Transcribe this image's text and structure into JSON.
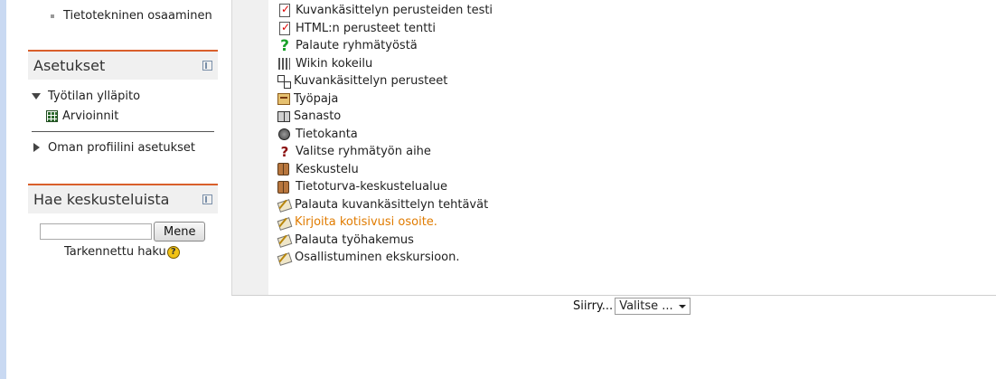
{
  "nav": {
    "top_item": "Tietotekninen osaaminen"
  },
  "settings_block": {
    "title": "Asetukset",
    "workspace": "Työtilan ylläpito",
    "grades": "Arvioinnit",
    "profile": "Oman profiilini asetukset"
  },
  "forum_search_block": {
    "title": "Hae keskusteluista",
    "input_value": "",
    "button_label": "Mene",
    "advanced_label": "Tarkennettu haku",
    "help_glyph": "?"
  },
  "activities": [
    {
      "icon": "quiz-icon",
      "label": "Kuvankäsittelyn perusteiden testi"
    },
    {
      "icon": "quiz-icon",
      "label": "HTML:n perusteet tentti"
    },
    {
      "icon": "feedback-icon",
      "label": "Palaute ryhmätyöstä"
    },
    {
      "icon": "wiki-icon",
      "label": "Wikin kokeilu"
    },
    {
      "icon": "lesson-icon",
      "label": "Kuvankäsittelyn perusteet"
    },
    {
      "icon": "workshop-icon",
      "label": "Työpaja"
    },
    {
      "icon": "glossary-icon",
      "label": "Sanasto"
    },
    {
      "icon": "database-icon",
      "label": "Tietokanta"
    },
    {
      "icon": "choice-icon",
      "label": "Valitse ryhmätyön aihe"
    },
    {
      "icon": "forum-icon",
      "label": "Keskustelu"
    },
    {
      "icon": "forum-icon",
      "label": "Tietoturva-keskustelualue"
    },
    {
      "icon": "assignment-icon",
      "label": "Palauta kuvankäsittelyn tehtävät"
    },
    {
      "icon": "assignment-icon",
      "label": "Kirjoita kotisivusi osoite."
    },
    {
      "icon": "assignment-icon",
      "label": "Palauta työhakemus"
    },
    {
      "icon": "assignment-icon",
      "label": "Osallistuminen ekskursioon."
    }
  ],
  "colors": {
    "block_header_accent": "#d95f2b",
    "highlight_link": "#e07b00"
  },
  "jump": {
    "label": "Siirry...",
    "selected": "Valitse ..."
  }
}
